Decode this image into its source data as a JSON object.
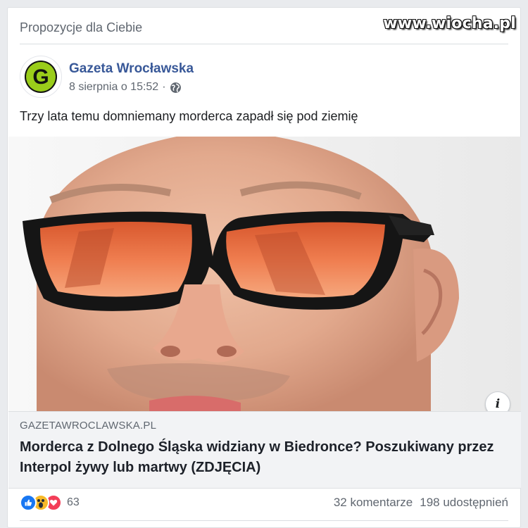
{
  "feed": {
    "section_title": "Propozycje dla Ciebie"
  },
  "watermark": {
    "text": "www.wiocha.pl"
  },
  "post": {
    "page_name": "Gazeta Wrocławska",
    "avatar_letter": "G",
    "date": "8 sierpnia o 15:52",
    "separator": "·",
    "privacy_icon": "globe-icon",
    "text": "Trzy lata temu domniemany morderca zapadł się pod ziemię"
  },
  "link": {
    "domain": "GAZETAWROCLAWSKA.PL",
    "title": "Morderca z Dolnego Śląska widziany w Biedronce? Poszukiwany przez Interpol żywy lub martwy (ZDJĘCIA)",
    "info_icon": "i"
  },
  "reactions": {
    "icons": [
      "like-icon",
      "wow-icon",
      "love-icon"
    ],
    "count": "63",
    "comments": "32 komentarze",
    "shares": "198 udostępnień"
  },
  "colors": {
    "brand_blue": "#385898",
    "logo_green": "#9acd1a",
    "like_blue": "#1877f2",
    "love_red": "#f33e58",
    "wow_yellow": "#f7b928"
  }
}
